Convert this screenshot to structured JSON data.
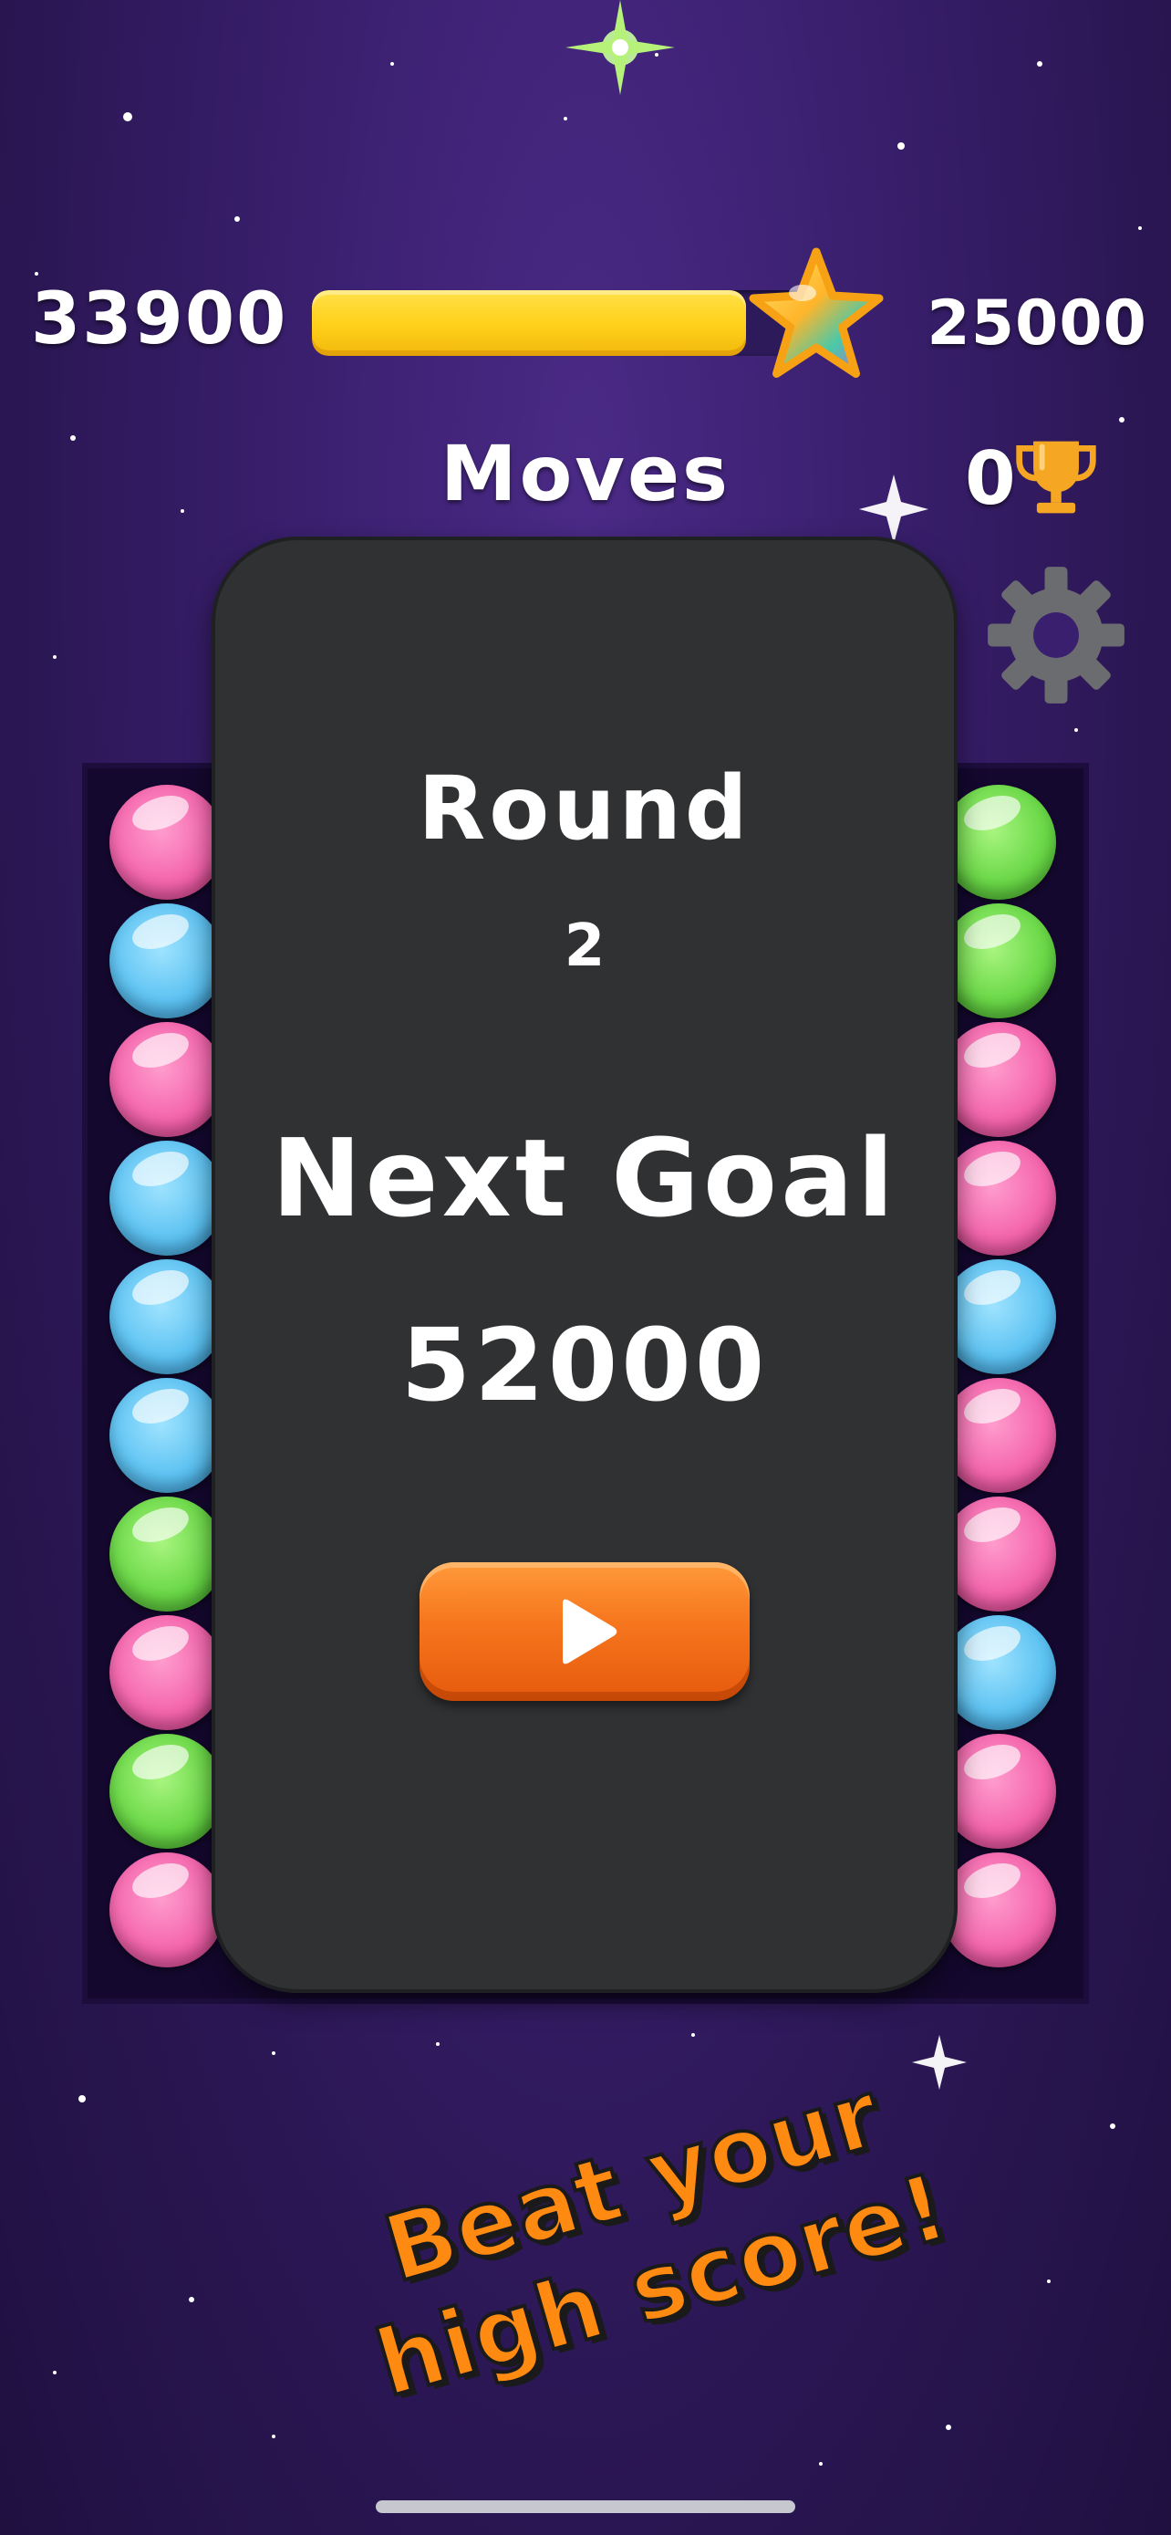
{
  "hud": {
    "score": "33900",
    "target_score": "25000",
    "progress": 0.85,
    "moves_label": "Moves",
    "trophies": "0"
  },
  "icons": {
    "progress_star": "star-icon",
    "trophy": "trophy-icon",
    "settings": "gear-icon",
    "play": "play-icon"
  },
  "board": {
    "left_column": [
      "pink",
      "blue",
      "pink",
      "blue",
      "blue",
      "blue",
      "green",
      "pink",
      "green",
      "pink"
    ],
    "right_column": [
      "green",
      "green",
      "pink",
      "pink",
      "blue",
      "pink",
      "pink",
      "blue",
      "pink",
      "pink"
    ]
  },
  "modal": {
    "round_label": "Round",
    "round_number": "2",
    "next_goal_label": "Next Goal",
    "next_goal_value": "52000"
  },
  "promo": {
    "line1": "Beat your",
    "line2": "high score!"
  },
  "colors": {
    "background": "#3a1f6e",
    "progress": "#ffd21c",
    "modal": "#2f3133",
    "play_button": "#f6751d",
    "promo_text": "#ff8a12",
    "bubble_pink": "#f466ad",
    "bubble_blue": "#5ec3f2",
    "bubble_green": "#6bd848"
  }
}
